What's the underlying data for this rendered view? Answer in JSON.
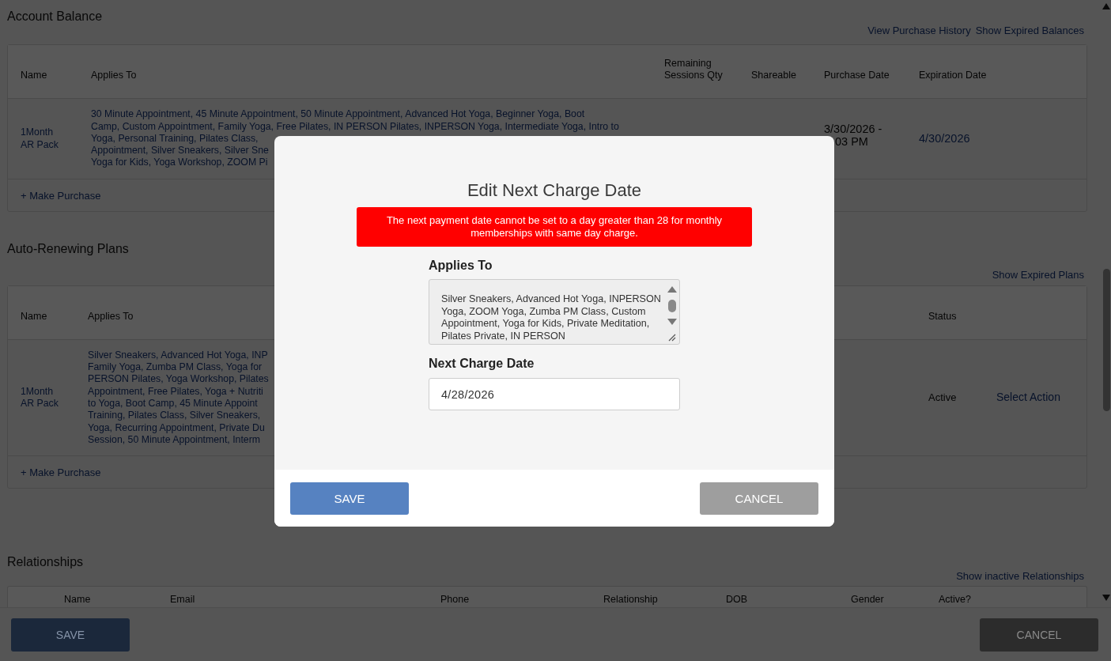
{
  "account_balance": {
    "title": "Account Balance",
    "links": [
      "View Purchase History",
      "Show Expired Balances"
    ],
    "columns": [
      "Name",
      "Applies To",
      "Remaining Sessions Qty",
      "Shareable",
      "Purchase Date",
      "Expiration Date"
    ],
    "rows": [
      {
        "name": "1Month AR Pack",
        "applies_to_lines": [
          "30 Minute Appointment, 45 Minute Appointment, 50 Minute Appointment, Advanced Hot Yoga, Beginner Yoga, Boot",
          "Camp, Custom Appointment, Family Yoga, Free Pilates, IN PERSON Pilates, INPERSON Yoga, Intermediate Yoga, Intro to",
          "Yoga, Personal Training, Pilates Class,",
          "Appointment, Silver Sneakers, Silver Sne",
          "Yoga for Kids, Yoga Workshop, ZOOM Pi"
        ],
        "purchase_date_lines": [
          "3/30/2026 -",
          "03 PM"
        ],
        "expiration_date": "4/30/2026"
      }
    ],
    "footer_link": "+ Make Purchase"
  },
  "auto_renewing_plans": {
    "title": "Auto-Renewing Plans",
    "links": [
      "Show Expired Plans"
    ],
    "columns": [
      "Name",
      "Applies To",
      "Status"
    ],
    "rows": [
      {
        "name": "1Month AR Pack",
        "applies_to_lines": [
          "Silver Sneakers, Advanced Hot Yoga, INP",
          "Family Yoga, Zumba PM Class, Yoga for",
          "PERSON Pilates, Yoga Workshop, Pilates",
          "Appointment, Free Pilates, Yoga + Nutriti",
          "to Yoga, Boot Camp, 45 Minute Appoint",
          "Training, Pilates Class, Silver Sneakers,",
          "Yoga, Recurring Appointment, Private Du",
          "Session, 50 Minute Appointment, Interm"
        ],
        "status": "Active",
        "action": "Select Action"
      }
    ],
    "footer_link": "+ Make Purchase"
  },
  "relationships": {
    "title": "Relationships",
    "links": [
      "Show inactive Relationships"
    ],
    "columns": [
      "Name",
      "Email",
      "Phone",
      "Relationship",
      "DOB",
      "Gender",
      "Active?"
    ]
  },
  "footer": {
    "buttons": [
      {
        "label": "SAVE",
        "kind": "primary"
      },
      {
        "label": "CANCEL",
        "kind": "secondary"
      }
    ]
  },
  "modal": {
    "title": "Edit Next Charge Date",
    "error": "The next payment date cannot be set to a day greater than 28 for monthly memberships with same day charge.",
    "fields": [
      {
        "kind": "textarea",
        "label": "Applies To",
        "value": "Silver Sneakers, Advanced Hot Yoga, INPERSON Yoga, ZOOM Yoga, Zumba PM Class, Custom Appointment, Yoga for Kids, Private Meditation, Pilates Private, IN PERSON"
      },
      {
        "kind": "input",
        "label": "Next Charge Date",
        "value": "4/28/2026"
      }
    ],
    "buttons": [
      {
        "label": "SAVE",
        "kind": "primary"
      },
      {
        "label": "CANCEL",
        "kind": "secondary"
      }
    ]
  }
}
